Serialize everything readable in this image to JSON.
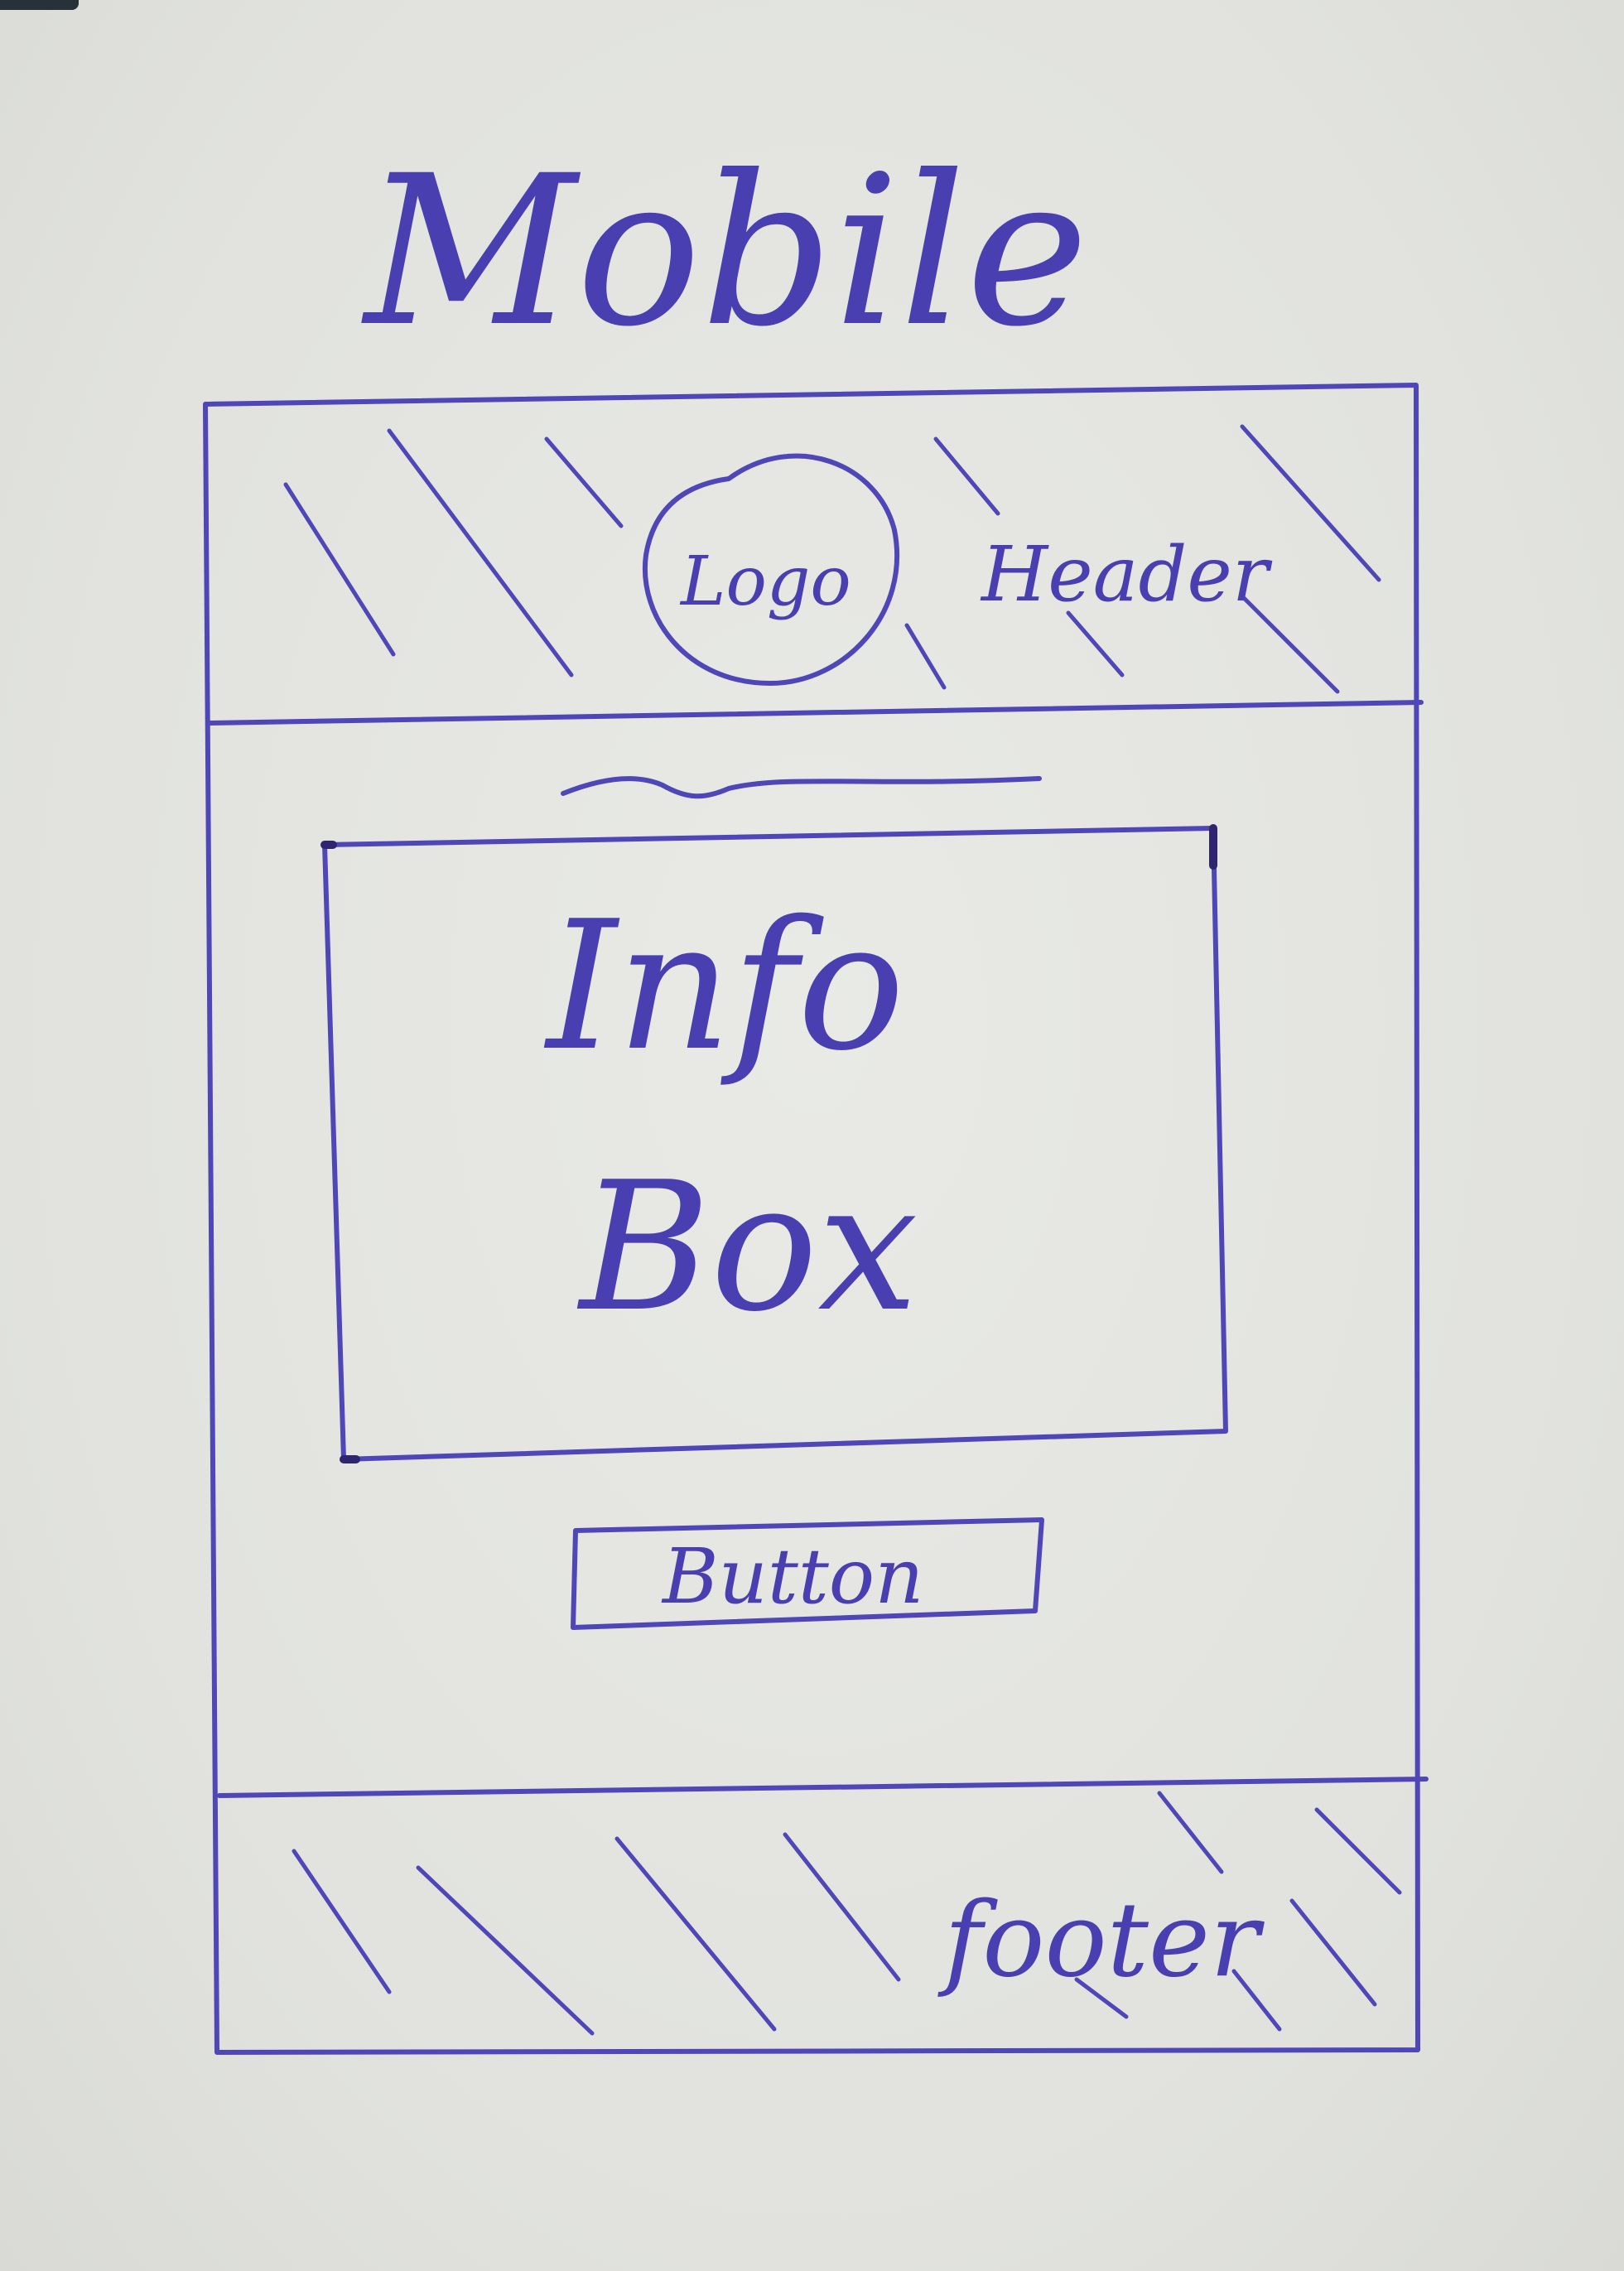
{
  "title": "Mobile",
  "header": {
    "logo_label": "Logo",
    "label": "Header"
  },
  "main": {
    "info_box_label_line1": "Info",
    "info_box_label_line2": "Box",
    "button_label": "Button"
  },
  "footer": {
    "label": "footer"
  },
  "colors": {
    "ink": "#4f46b8",
    "paper": "#e4e5e1"
  }
}
